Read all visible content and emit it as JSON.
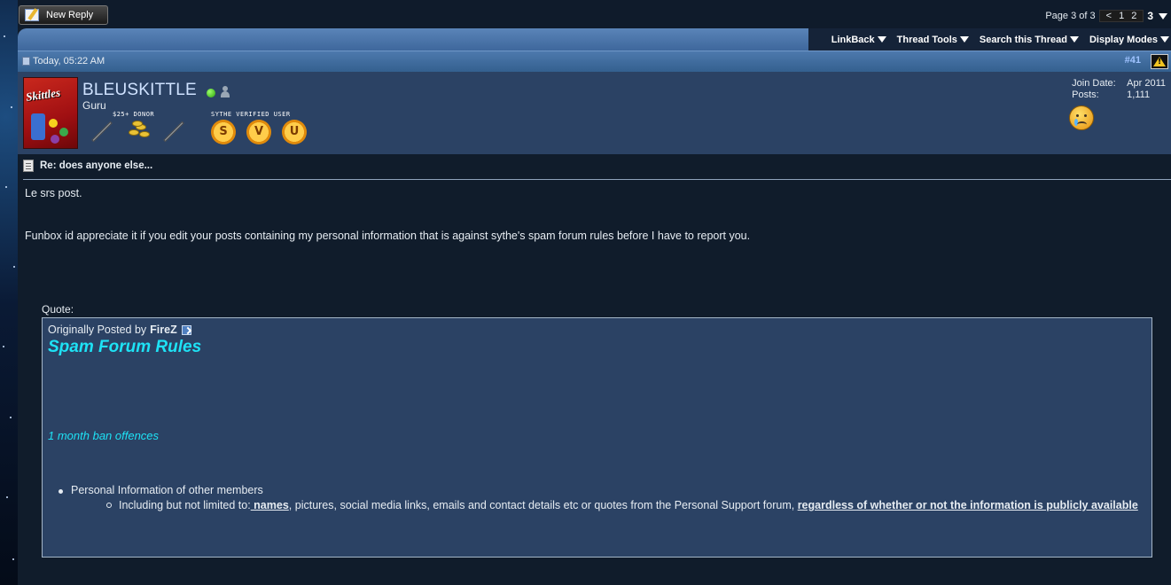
{
  "new_reply": {
    "label": "New Reply"
  },
  "pager": {
    "label": "Page 3 of 3",
    "prev": "<",
    "pages": [
      "1",
      "2"
    ],
    "current": "3"
  },
  "toolbar": {
    "items": [
      "LinkBack",
      "Thread Tools",
      "Search this Thread",
      "Display Modes"
    ]
  },
  "post": {
    "date": "Today, 05:22 AM",
    "number": "#41",
    "title": "Re: does anyone else...",
    "body": [
      "Le srs post.",
      "Funbox id appreciate it if you edit your posts containing my personal information that is against sythe's spam forum rules before I have to report you."
    ]
  },
  "user": {
    "name": "BLEUSKITTLE",
    "title": "Guru",
    "avatar_text": "Skittles",
    "badges": {
      "donor_label": "$25+ DONOR",
      "verified_label": "SYTHE VERIFIED USER",
      "medals": [
        "S",
        "V",
        "U"
      ]
    },
    "join_date_label": "Join Date:",
    "join_date": "Apr 2011",
    "posts_label": "Posts:",
    "posts": "1,111"
  },
  "quote": {
    "label": "Quote:",
    "originally_posted_by": "Originally Posted by",
    "author": "FireZ",
    "heading": "Spam Forum Rules",
    "subheading": "1 month ban offences",
    "item": "Personal Information of other members",
    "subitem_prefix": "Including but not limited to:",
    "subitem_names": " names",
    "subitem_middle": ", pictures, social media links, emails and contact details etc or quotes from the Personal Support forum, ",
    "subitem_emphasis": "regardless of whether or not the information is publicly available"
  }
}
